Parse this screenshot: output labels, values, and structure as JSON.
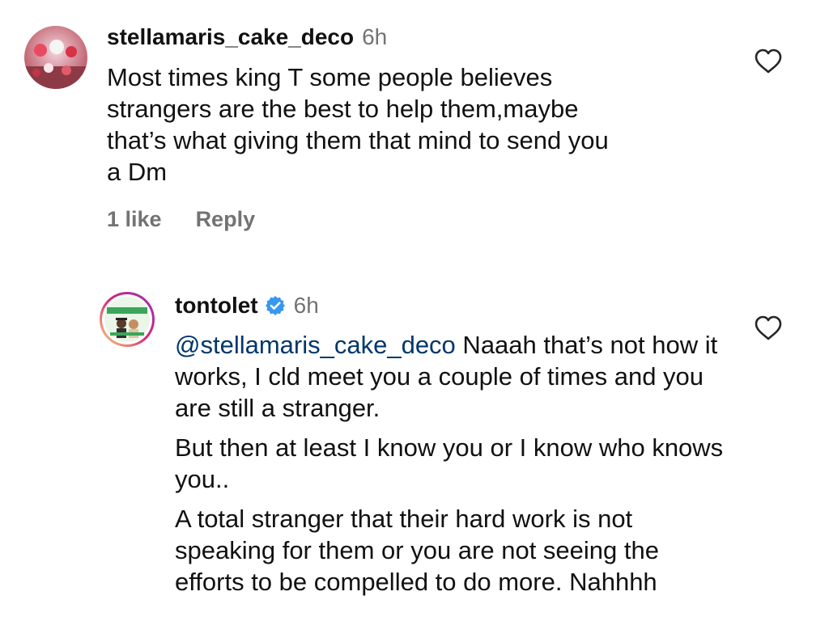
{
  "comments": [
    {
      "username": "stellamaris_cake_deco",
      "time": "6h",
      "text_lines": [
        "Most times king T some people believes",
        "strangers are the best to help them,maybe",
        "that’s what giving them that mind to send you",
        "a Dm"
      ],
      "likes": "1 like",
      "reply_label": "Reply"
    },
    {
      "username": "tontolet",
      "time": "6h",
      "verified": true,
      "mention": "@stellamaris_cake_deco",
      "paragraphs": [
        " Naaah that’s not how it works, I cld meet you a couple of times and you are still a stranger.",
        "But then at least I know you or I know who knows you..",
        "A total stranger that their hard work is not speaking for them or you are not seeing the efforts to be compelled to do more. Nahhhh"
      ]
    }
  ],
  "colors": {
    "verified_blue": "#3897f0",
    "mention_blue": "#00376b",
    "meta_gray": "#737373"
  },
  "icons": {
    "like": "heart-outline-icon",
    "verified": "verified-badge-icon"
  }
}
